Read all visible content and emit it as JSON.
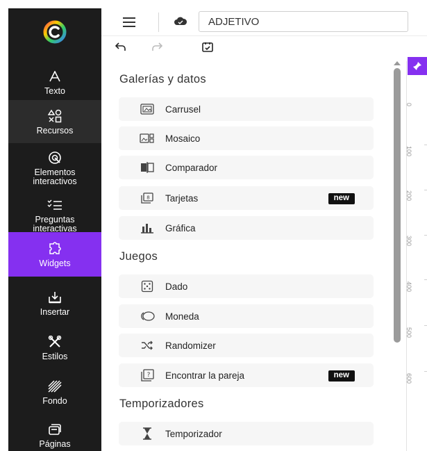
{
  "sidebar": {
    "items": [
      {
        "label": "Texto",
        "icon": "text-icon"
      },
      {
        "label": "Recursos",
        "icon": "shapes-icon"
      },
      {
        "label": "Elementos interactivos",
        "icon": "interactive-element-icon"
      },
      {
        "label": "Preguntas interactivas",
        "icon": "interactive-questions-icon"
      },
      {
        "label": "Widgets",
        "icon": "widgets-icon"
      },
      {
        "label": "Insertar",
        "icon": "insert-icon"
      },
      {
        "label": "Estilos",
        "icon": "styles-icon"
      },
      {
        "label": "Fondo",
        "icon": "background-icon"
      },
      {
        "label": "Páginas",
        "icon": "pages-icon"
      }
    ],
    "active_item": "Widgets",
    "accent_color": "#8530f0",
    "background_color": "#1c1c1c"
  },
  "header": {
    "title_value": "ADJETIVO"
  },
  "panel": {
    "sections": [
      {
        "title": "Galerías y datos",
        "items": [
          {
            "label": "Carrusel",
            "icon": "carousel-icon",
            "badge": ""
          },
          {
            "label": "Mosaico",
            "icon": "mosaic-icon",
            "badge": ""
          },
          {
            "label": "Comparador",
            "icon": "comparator-icon",
            "badge": ""
          },
          {
            "label": "Tarjetas",
            "icon": "cards-icon",
            "badge": "new"
          },
          {
            "label": "Gráfica",
            "icon": "bar-chart-icon",
            "badge": ""
          }
        ]
      },
      {
        "title": "Juegos",
        "items": [
          {
            "label": "Dado",
            "icon": "dice-icon",
            "badge": ""
          },
          {
            "label": "Moneda",
            "icon": "coin-icon",
            "badge": ""
          },
          {
            "label": "Randomizer",
            "icon": "shuffle-icon",
            "badge": ""
          },
          {
            "label": "Encontrar la pareja",
            "icon": "memory-game-icon",
            "badge": "new"
          }
        ]
      },
      {
        "title": "Temporizadores",
        "items": [
          {
            "label": "Temporizador",
            "icon": "hourglass-icon",
            "badge": ""
          }
        ]
      }
    ]
  },
  "ruler": {
    "labels": [
      "0",
      "100",
      "200",
      "300",
      "400",
      "500",
      "600"
    ]
  }
}
